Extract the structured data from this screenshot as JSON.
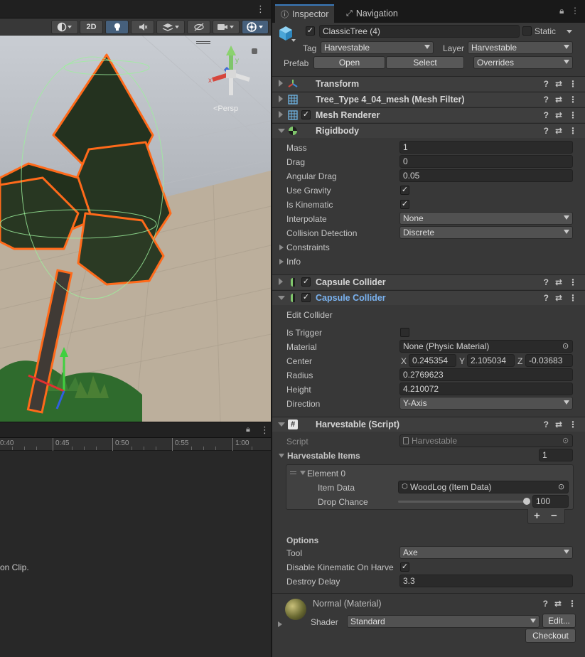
{
  "scene": {
    "toolbar": {
      "mode_2d": "2D"
    },
    "gizmo_label": "<Persp"
  },
  "animation": {
    "ticks": [
      "0:40",
      "0:45",
      "0:50",
      "0:55",
      "1:00"
    ],
    "message": "on Clip."
  },
  "inspector": {
    "tabs": {
      "inspector": "Inspector",
      "navigation": "Navigation"
    },
    "object": {
      "name": "ClassicTree (4)",
      "active": true,
      "static_label": "Static",
      "static": false,
      "tag_label": "Tag",
      "tag": "Harvestable",
      "layer_label": "Layer",
      "layer": "Harvestable",
      "prefab_label": "Prefab",
      "open_label": "Open",
      "select_label": "Select",
      "overrides_label": "Overrides"
    },
    "components": {
      "transform": "Transform",
      "mesh_filter": "Tree_Type 4_04_mesh (Mesh Filter)",
      "mesh_renderer": "Mesh Renderer",
      "rigidbody": "Rigidbody",
      "capsule_collider_1": "Capsule Collider",
      "capsule_collider_2": "Capsule Collider",
      "harvestable": "Harvestable (Script)"
    },
    "rigidbody": {
      "mass_label": "Mass",
      "mass": "1",
      "drag_label": "Drag",
      "drag": "0",
      "angular_drag_label": "Angular Drag",
      "angular_drag": "0.05",
      "use_gravity_label": "Use Gravity",
      "use_gravity": true,
      "is_kinematic_label": "Is Kinematic",
      "is_kinematic": true,
      "interpolate_label": "Interpolate",
      "interpolate": "None",
      "collision_label": "Collision Detection",
      "collision": "Discrete",
      "constraints_label": "Constraints",
      "info_label": "Info"
    },
    "capsule": {
      "edit_collider_label": "Edit Collider",
      "is_trigger_label": "Is Trigger",
      "is_trigger": false,
      "material_label": "Material",
      "material": "None (Physic Material)",
      "center_label": "Center",
      "center_x": "0.245354",
      "center_y": "2.105034",
      "center_z": "-0.03683",
      "radius_label": "Radius",
      "radius": "0.2769623",
      "height_label": "Height",
      "height": "4.210072",
      "direction_label": "Direction",
      "direction": "Y-Axis"
    },
    "harvestable": {
      "script_label": "Script",
      "script": "Harvestable",
      "items_label": "Harvestable Items",
      "items_count": "1",
      "element_label": "Element 0",
      "item_data_label": "Item Data",
      "item_data": "WoodLog (Item Data)",
      "drop_chance_label": "Drop Chance",
      "drop_chance": "100",
      "drop_chance_fraction": 1.0,
      "plus": "+",
      "minus": "−",
      "options_label": "Options",
      "tool_label": "Tool",
      "tool": "Axe",
      "disable_kin_label": "Disable Kinematic On Harve",
      "disable_kin": true,
      "destroy_delay_label": "Destroy Delay",
      "destroy_delay": "3.3"
    },
    "material": {
      "name": "Normal (Material)",
      "shader_label": "Shader",
      "shader": "Standard",
      "edit_label": "Edit...",
      "checkout_label": "Checkout"
    }
  }
}
